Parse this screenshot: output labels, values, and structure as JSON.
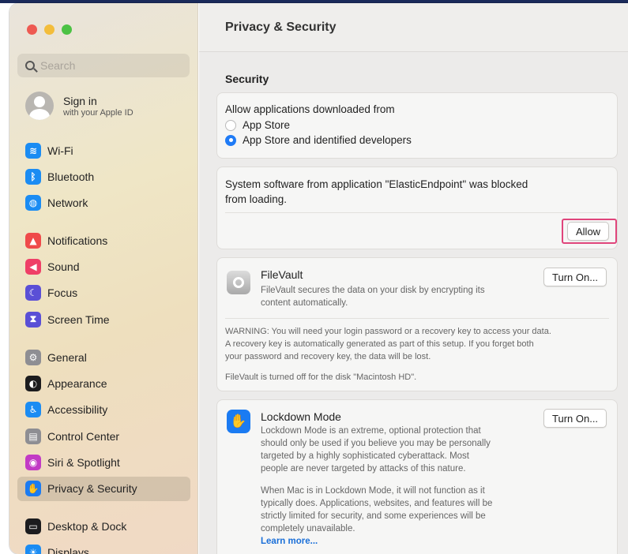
{
  "window": {
    "title": "Privacy & Security"
  },
  "sidebar": {
    "search_placeholder": "Search",
    "apple_id": {
      "title": "Sign in",
      "subtitle": "with your Apple ID"
    },
    "items": [
      {
        "label": "Wi-Fi",
        "icon": "wifi-icon",
        "color": "#1b8cf3",
        "glyph": "≋"
      },
      {
        "label": "Bluetooth",
        "icon": "bluetooth-icon",
        "color": "#1b8cf3",
        "glyph": "ᛒ"
      },
      {
        "label": "Network",
        "icon": "globe-icon",
        "color": "#1b8cf3",
        "glyph": "◍"
      },
      {
        "label": "Notifications",
        "icon": "bell-icon",
        "color": "#ef4a4a",
        "glyph": "▲"
      },
      {
        "label": "Sound",
        "icon": "speaker-icon",
        "color": "#ef3f67",
        "glyph": "◀"
      },
      {
        "label": "Focus",
        "icon": "moon-icon",
        "color": "#5a4fd6",
        "glyph": "☾"
      },
      {
        "label": "Screen Time",
        "icon": "hourglass-icon",
        "color": "#5a4fd6",
        "glyph": "⧗"
      },
      {
        "label": "General",
        "icon": "gear-icon",
        "color": "#8e8e93",
        "glyph": "⚙"
      },
      {
        "label": "Appearance",
        "icon": "appearance-icon",
        "color": "#1c1c1e",
        "glyph": "◐"
      },
      {
        "label": "Accessibility",
        "icon": "accessibility-icon",
        "color": "#1b8cf3",
        "glyph": "♿"
      },
      {
        "label": "Control Center",
        "icon": "control-center-icon",
        "color": "#8e8e93",
        "glyph": "▤"
      },
      {
        "label": "Siri & Spotlight",
        "icon": "siri-icon",
        "color": "#c23ac5",
        "glyph": "◉"
      },
      {
        "label": "Privacy & Security",
        "icon": "hand-icon",
        "color": "#1b7bf2",
        "glyph": "✋"
      },
      {
        "label": "Desktop & Dock",
        "icon": "dock-icon",
        "color": "#1c1c1e",
        "glyph": "▭"
      },
      {
        "label": "Displays",
        "icon": "display-icon",
        "color": "#1b8cf3",
        "glyph": "☀"
      }
    ]
  },
  "security": {
    "heading": "Security",
    "allow_from_label": "Allow applications downloaded from",
    "options": [
      {
        "label": "App Store",
        "selected": false
      },
      {
        "label": "App Store and identified developers",
        "selected": true
      }
    ],
    "blocked_message_line1": "System software from application \"ElasticEndpoint\" was blocked",
    "blocked_message_line2": "from loading.",
    "allow_button": "Allow"
  },
  "filevault": {
    "title": "FileVault",
    "description_line1": "FileVault secures the data on your disk by encrypting its",
    "description_line2": "content automatically.",
    "button": "Turn On...",
    "warning_line1": "WARNING: You will need your login password or a recovery key to access your data.",
    "warning_line2": "A recovery key is automatically generated as part of this setup. If you forget both",
    "warning_line3": "your password and recovery key, the data will be lost.",
    "status": "FileVault is turned off for the disk \"Macintosh HD\"."
  },
  "lockdown": {
    "title": "Lockdown Mode",
    "button": "Turn On...",
    "desc_line1": "Lockdown Mode is an extreme, optional protection that",
    "desc_line2": "should only be used if you believe you may be personally",
    "desc_line3": "targeted by a highly sophisticated cyberattack. Most",
    "desc_line4": "people are never targeted by attacks of this nature.",
    "desc2_line1": "When Mac is in Lockdown Mode, it will not function as it",
    "desc2_line2": "typically does. Applications, websites, and features will be",
    "desc2_line3": "strictly limited for security, and some experiences will be",
    "desc2_line4": "completely unavailable.",
    "learn_more": "Learn more..."
  }
}
